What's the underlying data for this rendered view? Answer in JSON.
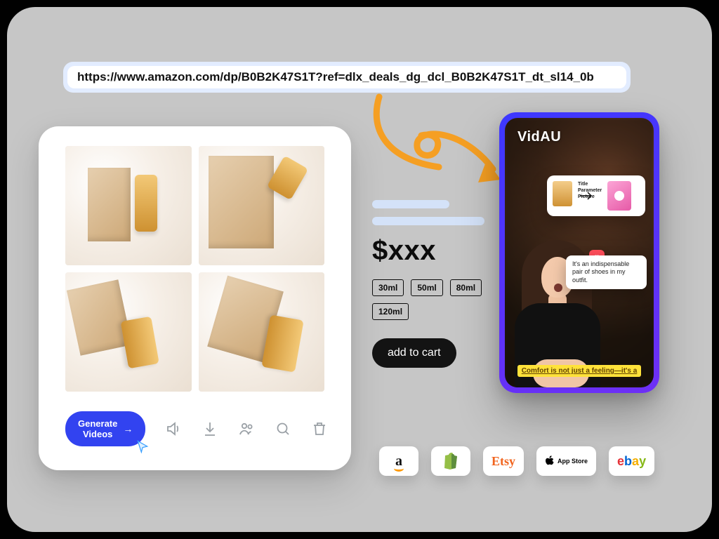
{
  "url_input": {
    "value": "https://www.amazon.com/dp/B0B2K47S1T?ref=dlx_deals_dg_dcl_B0B2K47S1T_dt_sl14_0b"
  },
  "product_card": {
    "generate_button": "Generate Videos",
    "icons": [
      "speaker-icon",
      "download-icon",
      "people-icon",
      "search-icon",
      "trash-icon"
    ]
  },
  "summary": {
    "price": "$xxx",
    "sizes": [
      "30ml",
      "50ml",
      "80ml",
      "120ml"
    ],
    "add_to_cart": "add to cart"
  },
  "phone_preview": {
    "brand": "VidAU",
    "card_lines": [
      "Title",
      "Parameter",
      "Picture"
    ],
    "quote": "It's an indispensable pair of shoes in my outfit.",
    "caption": "Comfort is not just a feeling—it's a"
  },
  "integrations": {
    "amazon": "a",
    "shopify": "shopify",
    "etsy": "Etsy",
    "appstore_icon": "apple",
    "appstore_label": "App Store",
    "ebay": {
      "e": "e",
      "b": "b",
      "a": "a",
      "y": "y"
    }
  }
}
